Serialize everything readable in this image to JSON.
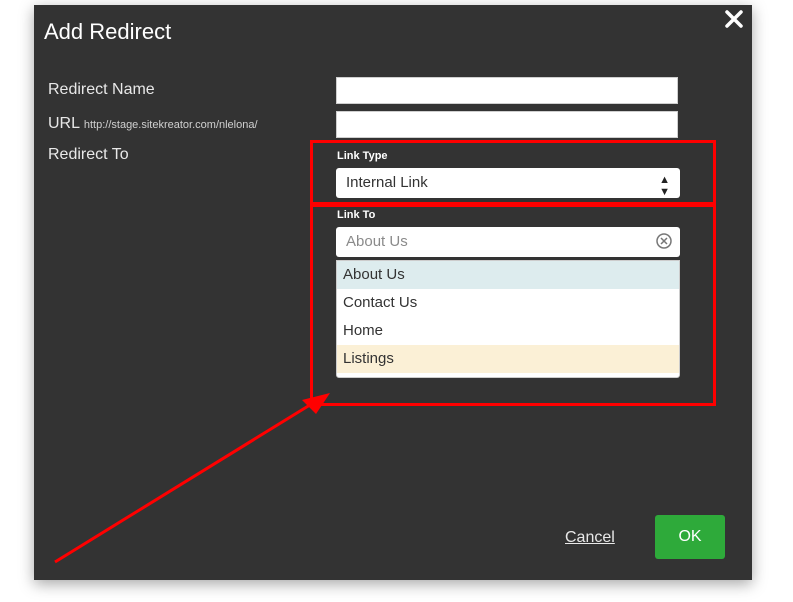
{
  "dialog": {
    "title": "Add Redirect",
    "close_icon": "close-icon"
  },
  "form": {
    "redirect_name_label": "Redirect Name",
    "redirect_name_value": "",
    "url_label": "URL",
    "url_base": "http://stage.sitekreator.com/nlelona/",
    "url_value": "",
    "redirect_to_label": "Redirect To",
    "link_type_label": "Link Type",
    "link_type_value": "Internal Link",
    "link_to_label": "Link To",
    "link_to_value": "About Us",
    "link_to_options": [
      "About Us",
      "Contact Us",
      "Home",
      "Listings"
    ]
  },
  "footer": {
    "cancel_label": "Cancel",
    "ok_label": "OK"
  },
  "colors": {
    "dialog_bg": "#333333",
    "ok_green": "#2eaa3a",
    "annotation_red": "#ff0000",
    "option_selected": "#ddecee",
    "option_hover": "#fbf0d6"
  }
}
